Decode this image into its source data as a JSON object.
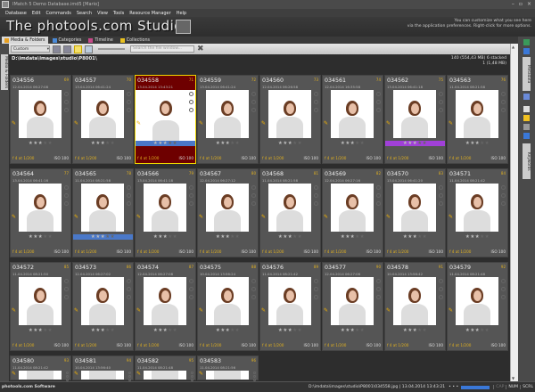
{
  "window": {
    "title": "IMatch 5 Demo Database.imd5 [Mario]",
    "controls": [
      "–",
      "▫",
      "×"
    ]
  },
  "menu": [
    "Database",
    "Edit",
    "Commands",
    "Search",
    "View",
    "Tools",
    "Resource Manager",
    "Help"
  ],
  "banner": {
    "brand": "The photools.com Studios",
    "hint_line1": "You can customize what you see here",
    "hint_line2": "via the application preferences. Right-click for more options."
  },
  "tabs": [
    {
      "label": "Media & Folders",
      "active": true
    },
    {
      "label": "Categories"
    },
    {
      "label": "Timeline"
    },
    {
      "label": "Collections"
    }
  ],
  "toolbar": {
    "layout_select": "Custom",
    "search_placeholder": "Search the file window..."
  },
  "left_tab": "Media & Folders",
  "path": "D:\\imdata\\images\\studio\\P8001\\",
  "stats": {
    "line1": "140 (554,43 MB) 6 stacked",
    "line2": "1 (1,48 MB)"
  },
  "colors": {
    "accent": "#f0d800",
    "selected_bg": "#6e0000",
    "blue_label": "#4a78c8",
    "purple_label": "#a040d8"
  },
  "items": [
    {
      "name": "034556",
      "date": "12.04.2014 06:27:08",
      "num": "69",
      "stars": 3,
      "label": "",
      "exposure": "f 4 at 1/200",
      "iso": "ISO 100"
    },
    {
      "name": "034557",
      "date": "13.04.2014 06:41:24",
      "num": "70",
      "stars": 3,
      "label": "",
      "exposure": "f 4 at 1/200",
      "iso": "ISO 100"
    },
    {
      "name": "034558",
      "date": "13.04.2014 13:43:21",
      "num": "71",
      "stars": 3,
      "label": "blue",
      "selected": true,
      "exposure": "f 4 at 1/200",
      "iso": "ISO 100"
    },
    {
      "name": "034559",
      "date": "13.04.2014 06:41:24",
      "num": "72",
      "stars": 3,
      "label": "",
      "exposure": "f 4 at 1/200",
      "iso": "ISO 100"
    },
    {
      "name": "034560",
      "date": "12.04.2014 06:26:58",
      "num": "73",
      "stars": 3,
      "label": "",
      "exposure": "f 4 at 1/200",
      "iso": "ISO 100"
    },
    {
      "name": "034561",
      "date": "12.04.2014 16:35:58",
      "num": "74",
      "stars": 3,
      "label": "",
      "exposure": "f 4 at 1/200",
      "iso": "ISO 100"
    },
    {
      "name": "034562",
      "date": "13.04.2014 06:41:18",
      "num": "75",
      "stars": 3,
      "label": "purple",
      "exposure": "f 4 at 1/200",
      "iso": "ISO 100"
    },
    {
      "name": "034563",
      "date": "11.04.2014 08:21:58",
      "num": "76",
      "stars": 3,
      "label": "",
      "exposure": "f 4 at 1/200",
      "iso": "ISO 100"
    },
    {
      "name": "034564",
      "date": "13.04.2014 06:41:16",
      "num": "77",
      "stars": 3,
      "label": "",
      "exposure": "f 4 at 1/200",
      "iso": "ISO 100"
    },
    {
      "name": "034565",
      "date": "11.04.2014 08:21:58",
      "num": "78",
      "stars": 3,
      "label": "blue",
      "exposure": "f 4 at 1/200",
      "iso": "ISO 100"
    },
    {
      "name": "034566",
      "date": "13.04.2014 06:41:18",
      "num": "79",
      "stars": 3,
      "label": "",
      "exposure": "f 4 at 1/200",
      "iso": "ISO 100"
    },
    {
      "name": "034567",
      "date": "12.04.2014 06:27:12",
      "num": "80",
      "stars": 3,
      "label": "",
      "exposure": "f 4 at 1/200",
      "iso": "ISO 100"
    },
    {
      "name": "034568",
      "date": "11.04.2014 08:21:58",
      "num": "81",
      "stars": 3,
      "label": "",
      "exposure": "f 4 at 1/200",
      "iso": "ISO 100"
    },
    {
      "name": "034569",
      "date": "12.04.2014 06:27:16",
      "num": "82",
      "stars": 3,
      "label": "",
      "exposure": "f 4 at 1/200",
      "iso": "ISO 100"
    },
    {
      "name": "034570",
      "date": "13.04.2014 06:41:20",
      "num": "83",
      "stars": 3,
      "label": "",
      "exposure": "f 4 at 1/200",
      "iso": "ISO 100"
    },
    {
      "name": "034571",
      "date": "11.04.2014 08:21:42",
      "num": "84",
      "stars": 3,
      "label": "",
      "exposure": "f 4 at 1/200",
      "iso": "ISO 100"
    },
    {
      "name": "034572",
      "date": "11.04.2014 08:21:50",
      "num": "85",
      "stars": 3,
      "label": "",
      "exposure": "f 4 at 1/200",
      "iso": "ISO 100"
    },
    {
      "name": "034573",
      "date": "12.04.2014 06:27:02",
      "num": "86",
      "stars": 3,
      "label": "",
      "exposure": "f 4 at 1/200",
      "iso": "ISO 100"
    },
    {
      "name": "034574",
      "date": "12.04.2014 06:27:08",
      "num": "87",
      "stars": 3,
      "label": "",
      "exposure": "f 4 at 1/200",
      "iso": "ISO 100"
    },
    {
      "name": "034575",
      "date": "10.04.2014 13:56:24",
      "num": "88",
      "stars": 3,
      "label": "",
      "exposure": "f 4 at 1/200",
      "iso": "ISO 100"
    },
    {
      "name": "034576",
      "date": "11.04.2014 08:21:42",
      "num": "89",
      "stars": 3,
      "label": "",
      "exposure": "f 4 at 1/200",
      "iso": "ISO 100"
    },
    {
      "name": "034577",
      "date": "12.04.2014 06:27:06",
      "num": "90",
      "stars": 3,
      "label": "",
      "exposure": "f 4 at 1/200",
      "iso": "ISO 100"
    },
    {
      "name": "034578",
      "date": "10.04.2014 13:56:42",
      "num": "91",
      "stars": 3,
      "label": "",
      "exposure": "f 4 at 1/200",
      "iso": "ISO 100"
    },
    {
      "name": "034579",
      "date": "11.04.2014 08:21:48",
      "num": "92",
      "stars": 3,
      "label": "",
      "exposure": "f 4 at 1/200",
      "iso": "ISO 100"
    },
    {
      "name": "034580",
      "date": "11.04.2014 08:21:42",
      "num": "93"
    },
    {
      "name": "034581",
      "date": "10.04.2014 13:56:40",
      "num": "94"
    },
    {
      "name": "034582",
      "date": "11.04.2014 08:21:48",
      "num": "95"
    },
    {
      "name": "034583",
      "date": "11.04.2014 08:21:56",
      "num": "96"
    }
  ],
  "right_panel": {
    "tab1": "Metadata",
    "tab2": "Keywords"
  },
  "status": {
    "left": "photools.com Software",
    "path": "D:\\imdata\\images\\studio\\P8001\\034558.jpg | 13.04.2014 13:43:21",
    "dots": "• • •",
    "caps": "CAP",
    "num": "NUM",
    "scrl": "SCRL"
  }
}
